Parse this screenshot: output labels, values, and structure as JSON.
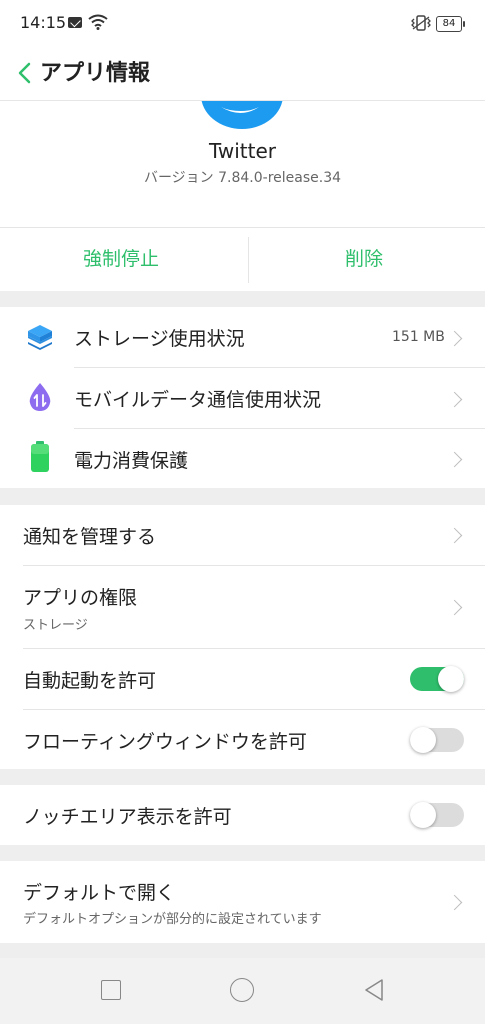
{
  "status_bar": {
    "time": "14:15",
    "battery": "84"
  },
  "header": {
    "title": "アプリ情報"
  },
  "app": {
    "name": "Twitter",
    "version": "バージョン 7.84.0-release.34"
  },
  "actions": {
    "force_stop": "強制停止",
    "delete": "削除"
  },
  "usage": {
    "storage": {
      "label": "ストレージ使用状況",
      "value": "151 MB"
    },
    "mobile_data": {
      "label": "モバイルデータ通信使用状況"
    },
    "power": {
      "label": "電力消費保護"
    }
  },
  "settings": {
    "notifications": {
      "label": "通知を管理する"
    },
    "permissions": {
      "label": "アプリの権限",
      "sub": "ストレージ"
    },
    "auto_start": {
      "label": "自動起動を許可",
      "enabled": true
    },
    "floating_window": {
      "label": "フローティングウィンドウを許可",
      "enabled": false
    }
  },
  "notch": {
    "label": "ノッチエリア表示を許可",
    "enabled": false
  },
  "default_open": {
    "label": "デフォルトで開く",
    "sub": "デフォルトオプションが部分的に設定されています"
  },
  "colors": {
    "accent": "#2fbf6c",
    "twitter": "#1d9bf0"
  }
}
